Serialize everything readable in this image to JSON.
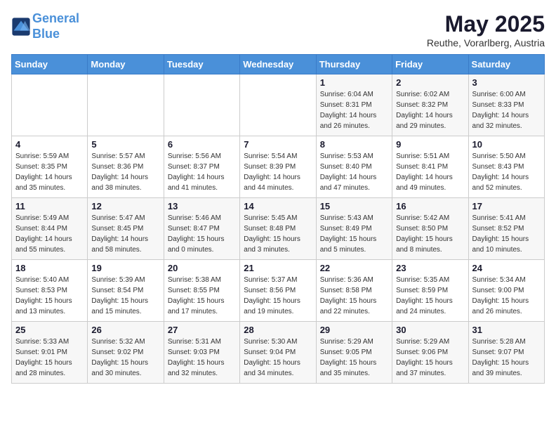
{
  "logo": {
    "line1": "General",
    "line2": "Blue"
  },
  "title": "May 2025",
  "location": "Reuthe, Vorarlberg, Austria",
  "days_of_week": [
    "Sunday",
    "Monday",
    "Tuesday",
    "Wednesday",
    "Thursday",
    "Friday",
    "Saturday"
  ],
  "weeks": [
    [
      {
        "day": "",
        "info": ""
      },
      {
        "day": "",
        "info": ""
      },
      {
        "day": "",
        "info": ""
      },
      {
        "day": "",
        "info": ""
      },
      {
        "day": "1",
        "info": "Sunrise: 6:04 AM\nSunset: 8:31 PM\nDaylight: 14 hours\nand 26 minutes."
      },
      {
        "day": "2",
        "info": "Sunrise: 6:02 AM\nSunset: 8:32 PM\nDaylight: 14 hours\nand 29 minutes."
      },
      {
        "day": "3",
        "info": "Sunrise: 6:00 AM\nSunset: 8:33 PM\nDaylight: 14 hours\nand 32 minutes."
      }
    ],
    [
      {
        "day": "4",
        "info": "Sunrise: 5:59 AM\nSunset: 8:35 PM\nDaylight: 14 hours\nand 35 minutes."
      },
      {
        "day": "5",
        "info": "Sunrise: 5:57 AM\nSunset: 8:36 PM\nDaylight: 14 hours\nand 38 minutes."
      },
      {
        "day": "6",
        "info": "Sunrise: 5:56 AM\nSunset: 8:37 PM\nDaylight: 14 hours\nand 41 minutes."
      },
      {
        "day": "7",
        "info": "Sunrise: 5:54 AM\nSunset: 8:39 PM\nDaylight: 14 hours\nand 44 minutes."
      },
      {
        "day": "8",
        "info": "Sunrise: 5:53 AM\nSunset: 8:40 PM\nDaylight: 14 hours\nand 47 minutes."
      },
      {
        "day": "9",
        "info": "Sunrise: 5:51 AM\nSunset: 8:41 PM\nDaylight: 14 hours\nand 49 minutes."
      },
      {
        "day": "10",
        "info": "Sunrise: 5:50 AM\nSunset: 8:43 PM\nDaylight: 14 hours\nand 52 minutes."
      }
    ],
    [
      {
        "day": "11",
        "info": "Sunrise: 5:49 AM\nSunset: 8:44 PM\nDaylight: 14 hours\nand 55 minutes."
      },
      {
        "day": "12",
        "info": "Sunrise: 5:47 AM\nSunset: 8:45 PM\nDaylight: 14 hours\nand 58 minutes."
      },
      {
        "day": "13",
        "info": "Sunrise: 5:46 AM\nSunset: 8:47 PM\nDaylight: 15 hours\nand 0 minutes."
      },
      {
        "day": "14",
        "info": "Sunrise: 5:45 AM\nSunset: 8:48 PM\nDaylight: 15 hours\nand 3 minutes."
      },
      {
        "day": "15",
        "info": "Sunrise: 5:43 AM\nSunset: 8:49 PM\nDaylight: 15 hours\nand 5 minutes."
      },
      {
        "day": "16",
        "info": "Sunrise: 5:42 AM\nSunset: 8:50 PM\nDaylight: 15 hours\nand 8 minutes."
      },
      {
        "day": "17",
        "info": "Sunrise: 5:41 AM\nSunset: 8:52 PM\nDaylight: 15 hours\nand 10 minutes."
      }
    ],
    [
      {
        "day": "18",
        "info": "Sunrise: 5:40 AM\nSunset: 8:53 PM\nDaylight: 15 hours\nand 13 minutes."
      },
      {
        "day": "19",
        "info": "Sunrise: 5:39 AM\nSunset: 8:54 PM\nDaylight: 15 hours\nand 15 minutes."
      },
      {
        "day": "20",
        "info": "Sunrise: 5:38 AM\nSunset: 8:55 PM\nDaylight: 15 hours\nand 17 minutes."
      },
      {
        "day": "21",
        "info": "Sunrise: 5:37 AM\nSunset: 8:56 PM\nDaylight: 15 hours\nand 19 minutes."
      },
      {
        "day": "22",
        "info": "Sunrise: 5:36 AM\nSunset: 8:58 PM\nDaylight: 15 hours\nand 22 minutes."
      },
      {
        "day": "23",
        "info": "Sunrise: 5:35 AM\nSunset: 8:59 PM\nDaylight: 15 hours\nand 24 minutes."
      },
      {
        "day": "24",
        "info": "Sunrise: 5:34 AM\nSunset: 9:00 PM\nDaylight: 15 hours\nand 26 minutes."
      }
    ],
    [
      {
        "day": "25",
        "info": "Sunrise: 5:33 AM\nSunset: 9:01 PM\nDaylight: 15 hours\nand 28 minutes."
      },
      {
        "day": "26",
        "info": "Sunrise: 5:32 AM\nSunset: 9:02 PM\nDaylight: 15 hours\nand 30 minutes."
      },
      {
        "day": "27",
        "info": "Sunrise: 5:31 AM\nSunset: 9:03 PM\nDaylight: 15 hours\nand 32 minutes."
      },
      {
        "day": "28",
        "info": "Sunrise: 5:30 AM\nSunset: 9:04 PM\nDaylight: 15 hours\nand 34 minutes."
      },
      {
        "day": "29",
        "info": "Sunrise: 5:29 AM\nSunset: 9:05 PM\nDaylight: 15 hours\nand 35 minutes."
      },
      {
        "day": "30",
        "info": "Sunrise: 5:29 AM\nSunset: 9:06 PM\nDaylight: 15 hours\nand 37 minutes."
      },
      {
        "day": "31",
        "info": "Sunrise: 5:28 AM\nSunset: 9:07 PM\nDaylight: 15 hours\nand 39 minutes."
      }
    ]
  ]
}
